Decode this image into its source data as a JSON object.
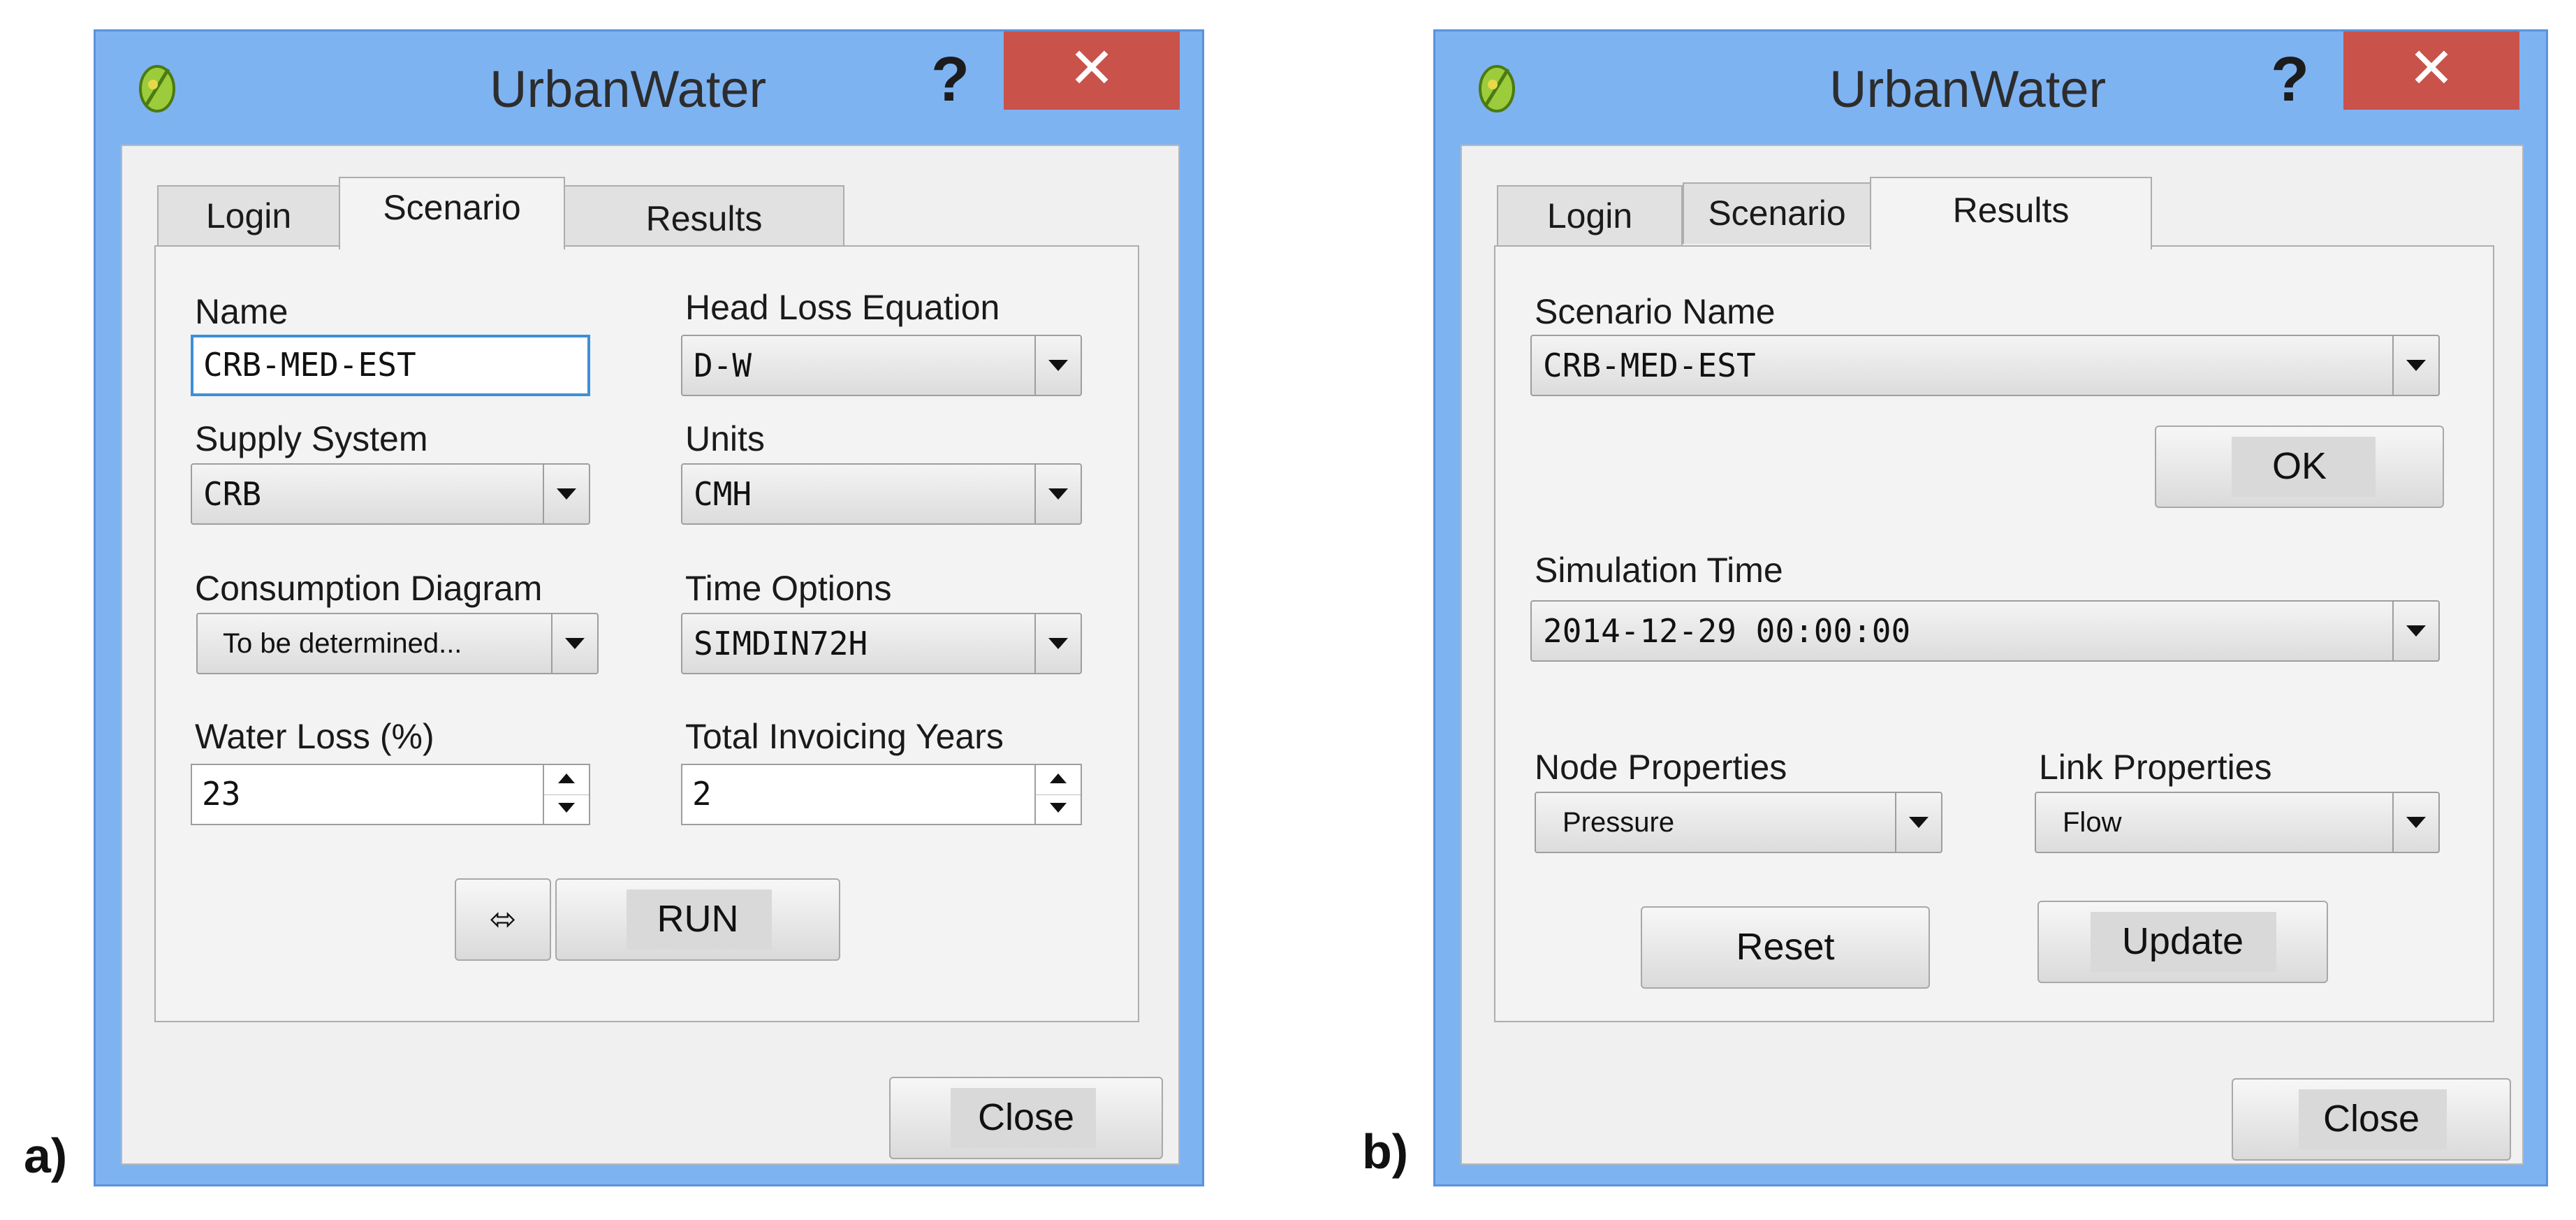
{
  "window_a": {
    "title": "UrbanWater",
    "help": "?",
    "close_symbol": "✕",
    "tabs": [
      "Login",
      "Scenario",
      "Results"
    ],
    "active_tab": "Scenario",
    "fields": {
      "name_label": "Name",
      "name_value": "CRB-MED-EST",
      "head_loss_label": "Head Loss Equation",
      "head_loss_value": "D-W",
      "supply_label": "Supply System",
      "supply_value": "CRB",
      "units_label": "Units",
      "units_value": "CMH",
      "consumption_label": "Consumption Diagram",
      "consumption_value": "To be determined...",
      "time_options_label": "Time Options",
      "time_options_value": "SIMDIN72H",
      "water_loss_label": "Water Loss (%)",
      "water_loss_value": "23",
      "invoicing_label": "Total Invoicing Years",
      "invoicing_value": "2"
    },
    "swap_symbol": "⬄",
    "run_label": "RUN",
    "close_label": "Close",
    "caption": "a)"
  },
  "window_b": {
    "title": "UrbanWater",
    "help": "?",
    "close_symbol": "✕",
    "tabs": [
      "Login",
      "Scenario",
      "Results"
    ],
    "active_tab": "Results",
    "scenario_name_label": "Scenario Name",
    "scenario_name_value": "CRB-MED-EST",
    "ok_label": "OK",
    "sim_time_label": "Simulation Time",
    "sim_time_value": "2014-12-29 00:00:00",
    "node_props_label": "Node Properties",
    "node_props_value": "Pressure",
    "link_props_label": "Link Properties",
    "link_props_value": "Flow",
    "reset_label": "Reset",
    "update_label": "Update",
    "close_label": "Close",
    "caption": "b)"
  },
  "colors": {
    "window_frame": "#7eb3f2",
    "close_button": "#c9524a",
    "focus_border": "#3e8fd8",
    "dialog_bg": "#f0f0f0"
  },
  "icons": {
    "app": "qgis-leaf-icon",
    "help": "help-icon",
    "close": "close-icon",
    "dropdown": "chevron-down-icon",
    "spin": "spinner-arrows-icon",
    "swap": "swap-arrows-icon"
  }
}
